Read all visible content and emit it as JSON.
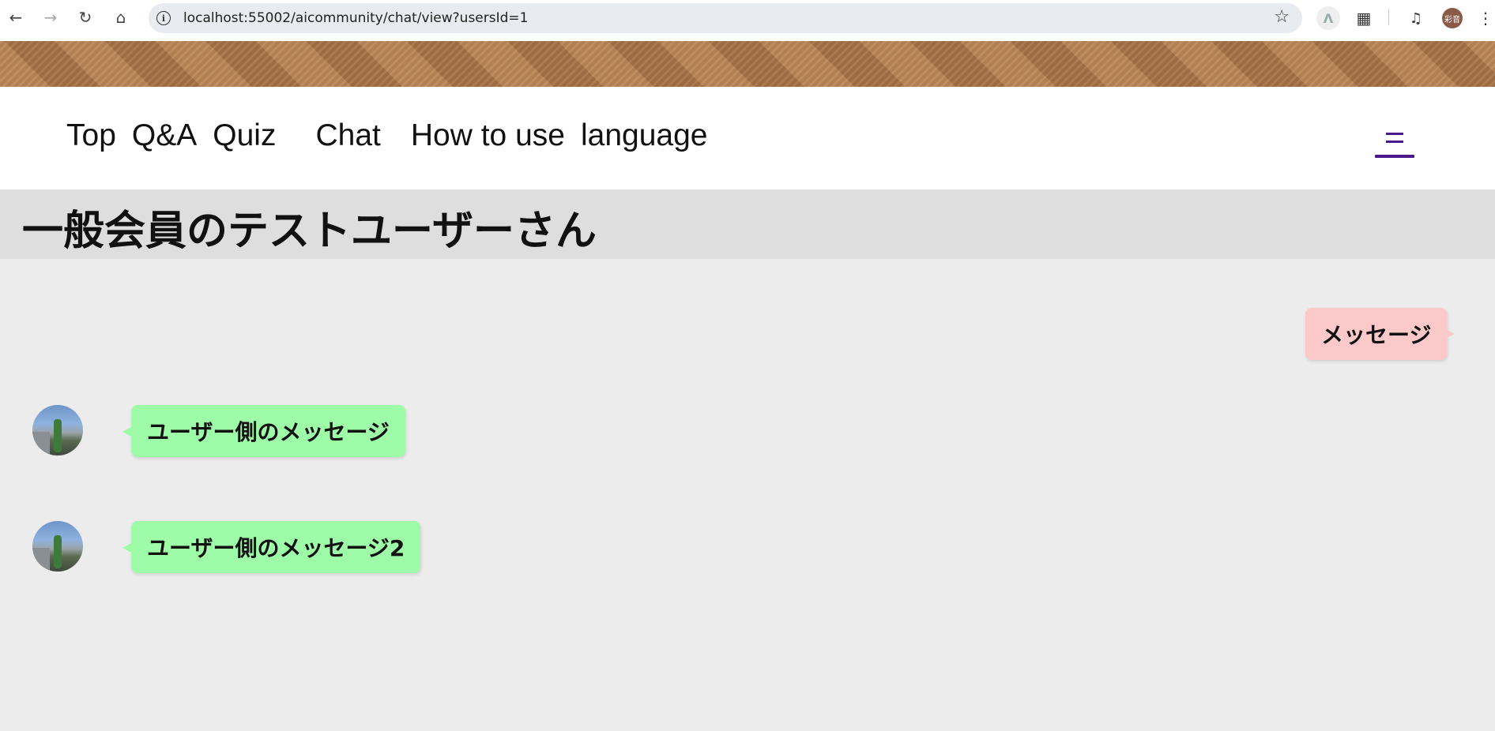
{
  "browser": {
    "url": "localhost:55002/aicommunity/chat/view?usersId=1",
    "profile_label": "彩音"
  },
  "nav": {
    "items": [
      "Top",
      "Q&A",
      "Quiz",
      "Chat",
      "How to use",
      "language"
    ]
  },
  "page": {
    "title": "一般会員のテストユーザーさん"
  },
  "messages": [
    {
      "side": "mine",
      "text": "メッセージ"
    },
    {
      "side": "theirs",
      "text": "ユーザー側のメッセージ"
    },
    {
      "side": "theirs",
      "text": "ユーザー側のメッセージ2"
    }
  ],
  "colors": {
    "mine_bubble": "#fbc9c9",
    "theirs_bubble": "#9efba8",
    "hamburger": "#4a1a8c",
    "title_band": "#dedede",
    "chat_bg": "#ececec"
  }
}
